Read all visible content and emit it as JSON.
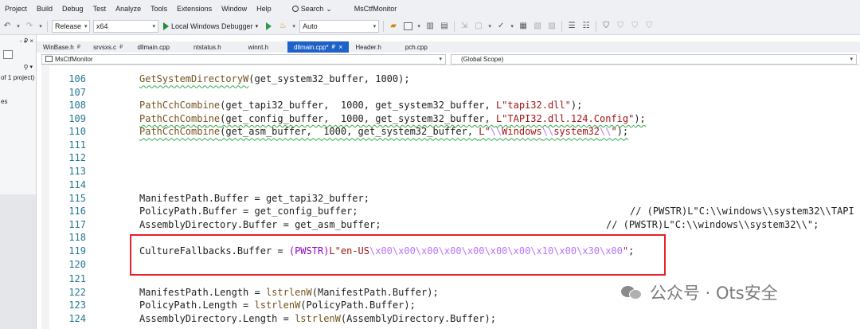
{
  "menu": [
    "Project",
    "Build",
    "Debug",
    "Test",
    "Analyze",
    "Tools",
    "Extensions",
    "Window",
    "Help"
  ],
  "search_label": "Search",
  "solution_name": "MsCtfMonitor",
  "toolbar": {
    "config": "Release",
    "platform": "x64",
    "debugger": "Local Windows Debugger",
    "auto": "Auto"
  },
  "left_panel": {
    "pin": "- ₽ ×",
    "text1": "of 1 project)",
    "text2": "es"
  },
  "tabs": [
    {
      "label": "WinBase.h",
      "pin": "₽",
      "active": false
    },
    {
      "label": "srvsxs.c",
      "pin": "₽",
      "active": false
    },
    {
      "label": "dllmain.cpp",
      "pin": "",
      "active": false
    },
    {
      "label": "ntstatus.h",
      "pin": "",
      "active": false
    },
    {
      "label": "winnt.h",
      "pin": "",
      "active": false
    },
    {
      "label": "dllmain.cpp*",
      "pin": "₽",
      "active": true
    },
    {
      "label": "Header.h",
      "pin": "",
      "active": false
    },
    {
      "label": "pch.cpp",
      "pin": "",
      "active": false
    }
  ],
  "nav": {
    "project": "MsCtfMonitor",
    "scope": "(Global Scope)"
  },
  "code_lines": [
    {
      "n": "106"
    },
    {
      "n": "107"
    },
    {
      "n": "108"
    },
    {
      "n": "109"
    },
    {
      "n": "110"
    },
    {
      "n": "111"
    },
    {
      "n": "112"
    },
    {
      "n": "113"
    },
    {
      "n": "114"
    },
    {
      "n": "115"
    },
    {
      "n": "116"
    },
    {
      "n": "117"
    },
    {
      "n": "118"
    },
    {
      "n": "119"
    },
    {
      "n": "120"
    },
    {
      "n": "121"
    },
    {
      "n": "122"
    },
    {
      "n": "123"
    },
    {
      "n": "124"
    }
  ],
  "code": {
    "l106_fn": "GetSystemDirectoryW",
    "l106_rest": "(get_system32_buffer, 1000);",
    "l108_fn": "PathCchCombine",
    "l108_mid": "(get_tapi32_buffer,  1000, get_system32_buffer, ",
    "l108_str": "L\"tapi32.dll\"",
    "l108_end": ");",
    "l109_fn": "PathCchCombine",
    "l109_mid": "(get_config_buffer,  1000, get_system32_buffer, ",
    "l109_str": "L\"TAPI32.dll.124.Config\"",
    "l109_end": ");",
    "l110_fn": "PathCchCombine",
    "l110_mid": "(get_asm_buffer,  1000, get_system32_buffer, ",
    "l110_s1": "L\"",
    "l110_e1": "\\\\",
    "l110_s2": "Windows",
    "l110_e2": "\\\\",
    "l110_s3": "system32",
    "l110_e3": "\\\\",
    "l110_s4": "\"",
    "l110_end": ");",
    "l115": "ManifestPath.Buffer = get_tapi32_buffer;",
    "l116": "PolicyPath.Buffer = get_config_buffer;",
    "l116_comment": "// (PWSTR)L\"C:\\\\windows\\\\system32\\\\TAPI",
    "l117": "AssemblyDirectory.Buffer = get_asm_buffer;",
    "l117_comment": "// (PWSTR)L\"C:\\\\windows\\\\system32\\\\\";",
    "l119_a": "CultureFallbacks.Buffer = ",
    "l119_mac": "(PWSTR)",
    "l119_str": "L\"en-US",
    "l119_esc": "\\x00\\x00\\x00\\x00\\x00\\x00\\x00\\x10\\x00\\x30\\x00",
    "l119_q": "\"",
    "l119_end": ";",
    "l122_a": "ManifestPath.Length = ",
    "l122_fn": "lstrlenW",
    "l122_b": "(ManifestPath.Buffer);",
    "l123_a": "PolicyPath.Length = ",
    "l123_fn": "lstrlenW",
    "l123_b": "(PolicyPath.Buffer);",
    "l124_a": "AssemblyDirectory.Length = ",
    "l124_fn": "lstrlenW",
    "l124_b": "(AssemblyDirectory.Buffer);"
  },
  "watermark": "公众号 · Ots安全",
  "colors": {
    "active_tab": "#1e62c9",
    "highlight_box": "#e8202a",
    "line_number": "#237893",
    "function": "#74531f",
    "string": "#a31515",
    "escape": "#b776fb",
    "macro": "#8f08c4"
  }
}
